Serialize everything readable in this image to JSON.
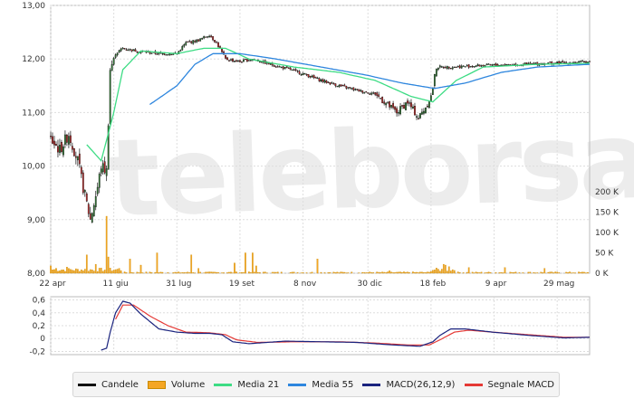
{
  "watermark": "teleborsa",
  "colors": {
    "candle": "#111111",
    "volume": "#f5a623",
    "ma21": "#3ddc84",
    "ma55": "#2e86de",
    "macd": "#1a237e",
    "signal": "#e53935",
    "grid": "#dddddd"
  },
  "legend": [
    {
      "label": "Candele",
      "key": "candle",
      "style": "line",
      "icon": "line-swatch-icon"
    },
    {
      "label": "Volume",
      "key": "volume",
      "style": "box",
      "icon": "bar-swatch-icon"
    },
    {
      "label": "Media 21",
      "key": "ma21",
      "style": "line",
      "icon": "line-swatch-icon"
    },
    {
      "label": "Media 55",
      "key": "ma55",
      "style": "line",
      "icon": "line-swatch-icon"
    },
    {
      "label": "MACD(26,12,9)",
      "key": "macd",
      "style": "line",
      "icon": "line-swatch-icon"
    },
    {
      "label": "Segnale MACD",
      "key": "signal",
      "style": "line",
      "icon": "line-swatch-icon"
    }
  ],
  "chart_data": [
    {
      "type": "line",
      "panel": "price",
      "ylim": [
        8.0,
        13.0
      ],
      "y_ticks": [
        "8,00",
        "9,00",
        "10,00",
        "11,00",
        "12,00",
        "13,00"
      ],
      "y_tick_values": [
        8,
        9,
        10,
        11,
        12,
        13
      ],
      "x_ticks": [
        "22 apr",
        "11 giu",
        "31 lug",
        "19 set",
        "8 nov",
        "30 dic",
        "18 feb",
        "9 apr",
        "29 mag"
      ],
      "x_tick_positions": [
        0,
        35,
        70,
        105,
        140,
        176,
        211,
        246,
        281
      ],
      "n_points": 300,
      "close_anchors": [
        [
          0,
          10.5
        ],
        [
          5,
          10.3
        ],
        [
          10,
          10.6
        ],
        [
          15,
          10.1
        ],
        [
          18,
          9.6
        ],
        [
          22,
          9.0
        ],
        [
          26,
          9.6
        ],
        [
          28,
          10.0
        ],
        [
          31,
          9.9
        ],
        [
          33,
          11.8
        ],
        [
          36,
          12.1
        ],
        [
          40,
          12.2
        ],
        [
          48,
          12.15
        ],
        [
          60,
          12.1
        ],
        [
          70,
          12.1
        ],
        [
          75,
          12.3
        ],
        [
          82,
          12.35
        ],
        [
          88,
          12.45
        ],
        [
          92,
          12.3
        ],
        [
          97,
          12.0
        ],
        [
          105,
          11.95
        ],
        [
          112,
          12.0
        ],
        [
          122,
          11.9
        ],
        [
          133,
          11.8
        ],
        [
          142,
          11.7
        ],
        [
          150,
          11.6
        ],
        [
          160,
          11.5
        ],
        [
          172,
          11.4
        ],
        [
          180,
          11.35
        ],
        [
          192,
          11.0
        ],
        [
          198,
          11.2
        ],
        [
          204,
          10.9
        ],
        [
          208,
          11.1
        ],
        [
          211,
          11.3
        ],
        [
          214,
          11.85
        ],
        [
          222,
          11.85
        ],
        [
          240,
          11.88
        ],
        [
          260,
          11.9
        ],
        [
          285,
          11.93
        ],
        [
          299,
          11.95
        ]
      ],
      "ma21_anchors": [
        [
          20,
          10.4
        ],
        [
          28,
          10.1
        ],
        [
          35,
          11.0
        ],
        [
          40,
          11.8
        ],
        [
          50,
          12.15
        ],
        [
          70,
          12.1
        ],
        [
          85,
          12.2
        ],
        [
          97,
          12.2
        ],
        [
          110,
          12.0
        ],
        [
          135,
          11.85
        ],
        [
          160,
          11.75
        ],
        [
          180,
          11.6
        ],
        [
          200,
          11.3
        ],
        [
          212,
          11.2
        ],
        [
          225,
          11.6
        ],
        [
          240,
          11.85
        ],
        [
          270,
          11.9
        ],
        [
          299,
          11.92
        ]
      ],
      "ma55_anchors": [
        [
          55,
          11.15
        ],
        [
          70,
          11.5
        ],
        [
          80,
          11.9
        ],
        [
          90,
          12.1
        ],
        [
          105,
          12.1
        ],
        [
          125,
          12.0
        ],
        [
          150,
          11.85
        ],
        [
          175,
          11.7
        ],
        [
          195,
          11.55
        ],
        [
          213,
          11.45
        ],
        [
          230,
          11.55
        ],
        [
          250,
          11.75
        ],
        [
          270,
          11.85
        ],
        [
          299,
          11.9
        ]
      ]
    },
    {
      "type": "bar",
      "panel": "volume",
      "ylim": [
        0,
        200000
      ],
      "y_ticks": [
        "0 K",
        "50 K",
        "100 K",
        "150 K",
        "200 K"
      ],
      "y_tick_values": [
        0,
        50000,
        100000,
        150000,
        200000
      ],
      "spikes": [
        [
          0,
          18000
        ],
        [
          3,
          12000
        ],
        [
          9,
          15000
        ],
        [
          20,
          45000
        ],
        [
          25,
          22000
        ],
        [
          31,
          140000
        ],
        [
          32,
          40000
        ],
        [
          38,
          12000
        ],
        [
          44,
          35000
        ],
        [
          50,
          20000
        ],
        [
          59,
          50000
        ],
        [
          78,
          45000
        ],
        [
          82,
          12000
        ],
        [
          102,
          25000
        ],
        [
          108,
          50000
        ],
        [
          112,
          50000
        ],
        [
          114,
          18000
        ],
        [
          148,
          35000
        ],
        [
          188,
          6000
        ],
        [
          218,
          22000
        ],
        [
          219,
          20000
        ],
        [
          221,
          16000
        ],
        [
          232,
          14000
        ],
        [
          252,
          14000
        ],
        [
          274,
          12000
        ]
      ]
    },
    {
      "type": "line",
      "panel": "macd",
      "ylim": [
        -0.25,
        0.65
      ],
      "y_ticks": [
        "-0,2",
        "0",
        "0,2",
        "0,4",
        "0,6"
      ],
      "y_tick_values": [
        -0.2,
        0,
        0.2,
        0.4,
        0.6
      ],
      "macd_anchors": [
        [
          28,
          -0.18
        ],
        [
          31,
          -0.15
        ],
        [
          33,
          0.1
        ],
        [
          36,
          0.4
        ],
        [
          40,
          0.58
        ],
        [
          44,
          0.55
        ],
        [
          50,
          0.38
        ],
        [
          60,
          0.15
        ],
        [
          70,
          0.1
        ],
        [
          80,
          0.08
        ],
        [
          88,
          0.08
        ],
        [
          95,
          0.06
        ],
        [
          101,
          -0.05
        ],
        [
          110,
          -0.08
        ],
        [
          130,
          -0.04
        ],
        [
          150,
          -0.05
        ],
        [
          170,
          -0.06
        ],
        [
          190,
          -0.1
        ],
        [
          205,
          -0.12
        ],
        [
          212,
          -0.05
        ],
        [
          216,
          0.05
        ],
        [
          222,
          0.15
        ],
        [
          230,
          0.15
        ],
        [
          245,
          0.1
        ],
        [
          265,
          0.05
        ],
        [
          285,
          0.01
        ],
        [
          299,
          0.02
        ]
      ],
      "signal_anchors": [
        [
          36,
          0.3
        ],
        [
          40,
          0.52
        ],
        [
          46,
          0.52
        ],
        [
          55,
          0.35
        ],
        [
          65,
          0.2
        ],
        [
          75,
          0.1
        ],
        [
          88,
          0.09
        ],
        [
          97,
          0.06
        ],
        [
          103,
          -0.02
        ],
        [
          115,
          -0.06
        ],
        [
          135,
          -0.05
        ],
        [
          160,
          -0.05
        ],
        [
          180,
          -0.07
        ],
        [
          198,
          -0.1
        ],
        [
          210,
          -0.1
        ],
        [
          216,
          -0.02
        ],
        [
          224,
          0.1
        ],
        [
          232,
          0.13
        ],
        [
          245,
          0.1
        ],
        [
          265,
          0.06
        ],
        [
          285,
          0.02
        ],
        [
          299,
          0.02
        ]
      ]
    }
  ]
}
